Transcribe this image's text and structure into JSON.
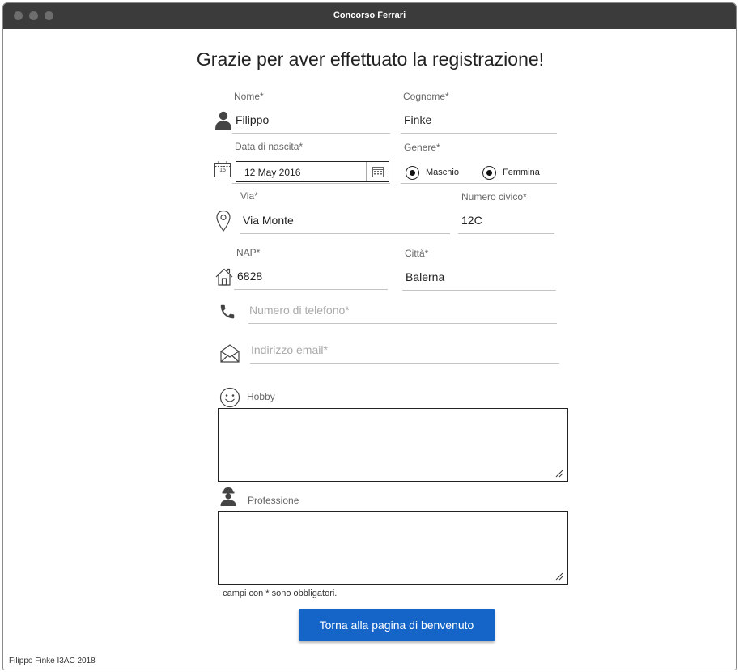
{
  "window": {
    "title": "Concorso Ferrari"
  },
  "heading": "Grazie per aver effettuato la registrazione!",
  "form": {
    "nome": {
      "label": "Nome*",
      "value": "Filippo"
    },
    "cognome": {
      "label": "Cognome*",
      "value": "Finke"
    },
    "data_nascita": {
      "label": "Data di nascita*",
      "value": "12 May 2016",
      "calendar_day": "15"
    },
    "genere": {
      "label": "Genere*",
      "options": [
        {
          "label": "Maschio",
          "selected": true
        },
        {
          "label": "Femmina",
          "selected": true
        }
      ]
    },
    "via": {
      "label": "Via*",
      "value": "Via Monte"
    },
    "numero_civico": {
      "label": "Numero civico*",
      "value": "12C"
    },
    "nap": {
      "label": "NAP*",
      "value": "6828"
    },
    "citta": {
      "label": "Città*",
      "value": "Balerna"
    },
    "telefono": {
      "placeholder": "Numero di telefono*"
    },
    "email": {
      "placeholder": "Indirizzo email*"
    },
    "hobby": {
      "label": "Hobby",
      "value": ""
    },
    "professione": {
      "label": "Professione",
      "value": ""
    }
  },
  "note": "I campi con * sono obbligatori.",
  "button": {
    "label": "Torna alla pagina di benvenuto"
  },
  "footer": "Filippo Finke I3AC 2018",
  "colors": {
    "titlebar": "#3b3b3b",
    "button": "#1565c8",
    "underline": "#c4c4c4",
    "icon": "#444444"
  },
  "icons": [
    "person-icon",
    "calendar-icon",
    "calendar-picker-icon",
    "location-pin-icon",
    "home-icon",
    "phone-icon",
    "envelope-icon",
    "smiley-icon",
    "worker-icon"
  ]
}
